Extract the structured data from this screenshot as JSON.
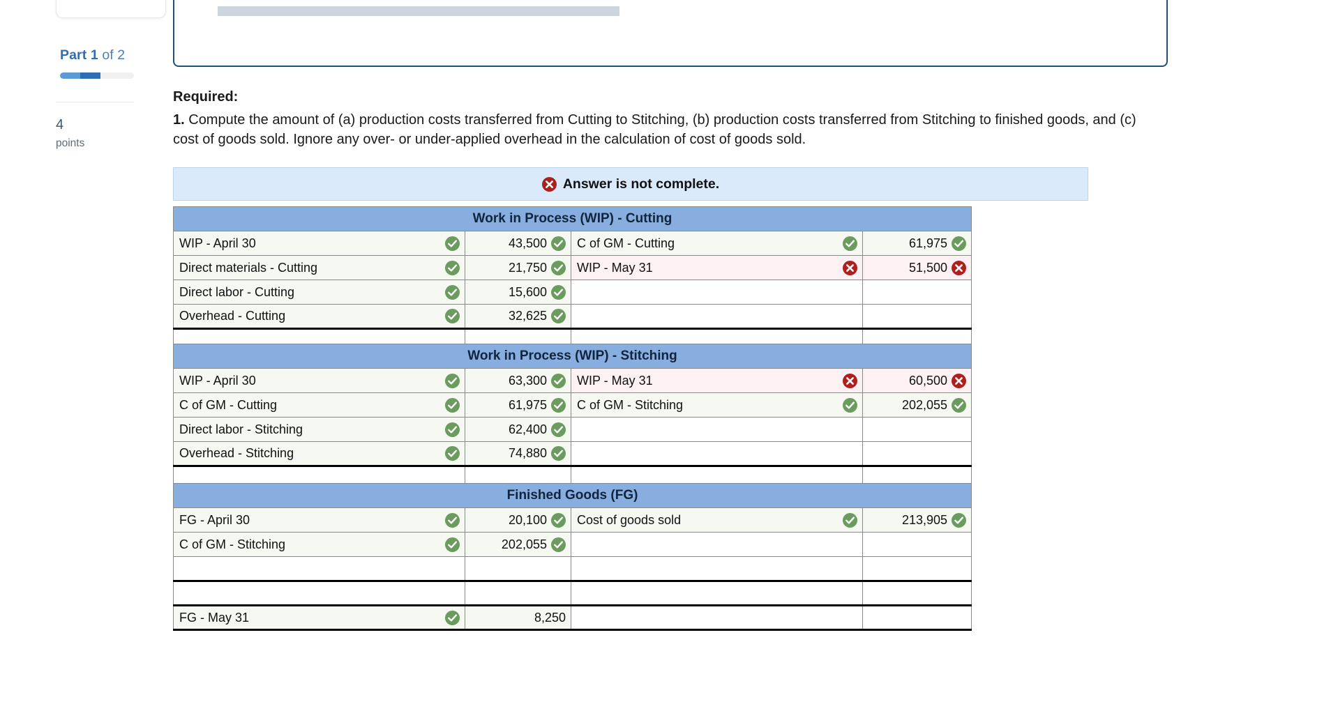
{
  "sidebar": {
    "part_label_strong": "Part 1",
    "part_label_rest": " of 2",
    "points_number": "4",
    "points_word": "points",
    "progress_percent": 55
  },
  "question_card": {
    "cut_text": "",
    "has_skeleton_bar": true
  },
  "required": {
    "heading": "Required:",
    "number": "1.",
    "text": " Compute the amount of (a) production costs transferred from Cutting to Stitching, (b) production costs transferred from Stitching to finished goods, and (c) cost of goods sold. Ignore any over- or under-applied overhead in the calculation of cost of goods sold."
  },
  "alert": {
    "icon": "error-circle-icon",
    "message": "Answer is not complete."
  },
  "colors": {
    "section_header_bg": "#87aede",
    "alert_bg": "#dbeafb",
    "correct_bg": "#f5f9f1",
    "wrong_bg": "#fdf1f3",
    "gray_row": "#c9c9c9",
    "ok_green": "#6b9b5e",
    "bad_red": "#ad2020",
    "accent_blue": "#2f6db5"
  },
  "tables": [
    {
      "title": "Work in Process (WIP) - Cutting",
      "rows": [
        {
          "left_label": "WIP - April 30",
          "left_status": "ok",
          "left_amount": "43,500",
          "left_amount_status": "ok",
          "right_label": "C of GM - Cutting",
          "right_status": "ok",
          "right_amount": "61,975",
          "right_amount_status": "ok"
        },
        {
          "left_label": "Direct materials - Cutting",
          "left_status": "ok",
          "left_amount": "21,750",
          "left_amount_status": "ok",
          "right_label": "WIP - May 31",
          "right_status": "bad",
          "right_amount": "51,500",
          "right_amount_status": "bad"
        },
        {
          "left_label": "Direct labor - Cutting",
          "left_status": "ok",
          "left_amount": "15,600",
          "left_amount_status": "ok",
          "right_label": "",
          "right_status": "",
          "right_amount": "",
          "right_amount_status": ""
        },
        {
          "left_label": "Overhead - Cutting",
          "left_status": "ok",
          "left_amount": "32,625",
          "left_amount_status": "ok",
          "right_label": "",
          "right_status": "",
          "right_amount": "",
          "right_amount_status": ""
        },
        {
          "left_label": "",
          "left_status": "",
          "left_amount": "",
          "left_amount_status": "",
          "right_label": "",
          "right_status": "",
          "right_amount": "",
          "right_amount_status": "",
          "total_rule": true
        }
      ]
    },
    {
      "title": "Work in Process (WIP) - Stitching",
      "rows": [
        {
          "left_label": "WIP - April 30",
          "left_status": "ok",
          "left_amount": "63,300",
          "left_amount_status": "ok",
          "right_label": "WIP - May 31",
          "right_status": "bad",
          "right_amount": "60,500",
          "right_amount_status": "bad"
        },
        {
          "left_label": "C of GM - Cutting",
          "left_status": "ok",
          "left_amount": "61,975",
          "left_amount_status": "ok",
          "right_label": "C of GM - Stitching",
          "right_status": "ok",
          "right_amount": "202,055",
          "right_amount_status": "ok"
        },
        {
          "left_label": "Direct labor - Stitching",
          "left_status": "ok",
          "left_amount": "62,400",
          "left_amount_status": "ok",
          "right_label": "",
          "right_status": "",
          "right_amount": "",
          "right_amount_status": ""
        },
        {
          "left_label": "Overhead - Stitching",
          "left_status": "ok",
          "left_amount": "74,880",
          "left_amount_status": "ok",
          "right_label": "",
          "right_status": "",
          "right_amount": "",
          "right_amount_status": ""
        },
        {
          "left_label": "",
          "left_status": "",
          "left_amount": "",
          "left_amount_status": "",
          "right_label": "",
          "right_status": "",
          "right_amount": "",
          "right_amount_status": "",
          "total_rule": true
        }
      ]
    },
    {
      "title": "Finished Goods (FG)",
      "rows": [
        {
          "left_label": "FG - April 30",
          "left_status": "ok",
          "left_amount": "20,100",
          "left_amount_status": "ok",
          "right_label": "Cost of goods sold",
          "right_status": "ok",
          "right_amount": "213,905",
          "right_amount_status": "ok"
        },
        {
          "left_label": "C of GM - Stitching",
          "left_status": "ok",
          "left_amount": "202,055",
          "left_amount_status": "ok",
          "right_label": "",
          "right_status": "",
          "right_amount": "",
          "right_amount_status": ""
        },
        {
          "left_label": "",
          "left_status": "",
          "left_amount": "",
          "left_amount_status": "",
          "right_label": "",
          "right_status": "",
          "right_amount": "",
          "right_amount_status": ""
        },
        {
          "left_label": "",
          "left_status": "",
          "left_amount": "",
          "left_amount_status": "",
          "right_label": "",
          "right_status": "",
          "right_amount": "",
          "right_amount_status": "",
          "total_rule": true
        },
        {
          "left_label": "FG - May 31",
          "left_status": "ok",
          "left_amount": "8,250",
          "left_amount_status": "",
          "right_label": "",
          "right_status": "",
          "right_amount": "",
          "right_amount_status": "",
          "final_row": true
        }
      ]
    }
  ]
}
